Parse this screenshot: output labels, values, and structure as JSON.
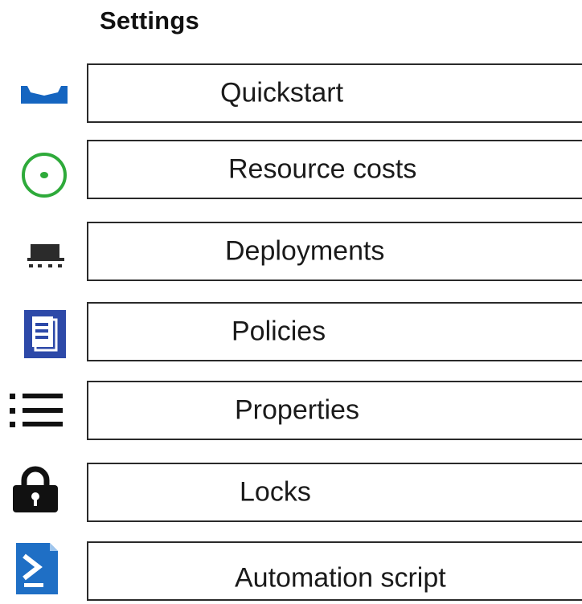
{
  "header": {
    "title": "Settings"
  },
  "colors": {
    "quickstart_icon": "#1565c0",
    "resource_costs_icon": "#2eaa3a",
    "deployments_icon": "#2b2b2b",
    "policies_icon": "#2d49a8",
    "properties_icon": "#111111",
    "locks_icon": "#111111",
    "automation_icon": "#1f6fc5",
    "border": "#2a2a2a"
  },
  "menu": {
    "items": [
      {
        "label": "Quickstart",
        "icon": "quickstart-icon"
      },
      {
        "label": "Resource costs",
        "icon": "resource-costs-icon"
      },
      {
        "label": "Deployments",
        "icon": "deployments-icon"
      },
      {
        "label": "Policies",
        "icon": "policies-icon"
      },
      {
        "label": "Properties",
        "icon": "properties-icon"
      },
      {
        "label": "Locks",
        "icon": "lock-icon"
      },
      {
        "label": "Automation script",
        "icon": "automation-script-icon"
      }
    ]
  }
}
